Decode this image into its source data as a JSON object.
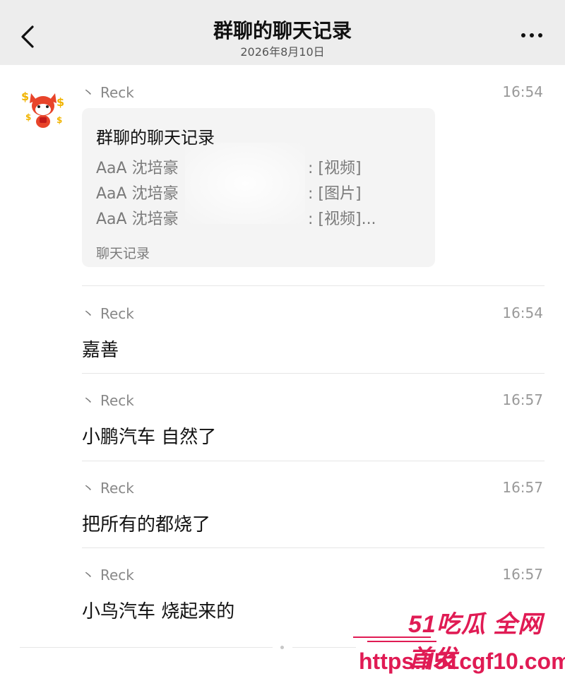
{
  "header": {
    "title": "群聊的聊天记录",
    "date": "2026年8月10日"
  },
  "messages": [
    {
      "sender": "Reck",
      "time": "16:54",
      "card": {
        "title": "群聊的聊天记录",
        "lines": [
          {
            "name": "AaA 沈培豪",
            "kind": ": [视频]"
          },
          {
            "name": "AaA 沈培豪",
            "kind": ": [图片]"
          },
          {
            "name": "AaA 沈培豪",
            "kind": ": [视频]..."
          }
        ],
        "footer": "聊天记录"
      }
    },
    {
      "sender": "Reck",
      "time": "16:54",
      "text": "嘉善"
    },
    {
      "sender": "Reck",
      "time": "16:57",
      "text": "小鹏汽车 自然了"
    },
    {
      "sender": "Reck",
      "time": "16:57",
      "text": "把所有的都烧了"
    },
    {
      "sender": "Reck",
      "time": "16:57",
      "text": "小鸟汽车 烧起来的"
    }
  ],
  "watermark": {
    "logo": "51吃瓜 全网首发",
    "url": "https://51cgf10.com"
  },
  "colors": {
    "header_bg": "#ededed",
    "card_bg": "#f4f4f4",
    "watermark": "#e01b54"
  },
  "icons": [
    "back-chevron-icon",
    "more-dots-icon",
    "avatar-cartoon-fox"
  ]
}
